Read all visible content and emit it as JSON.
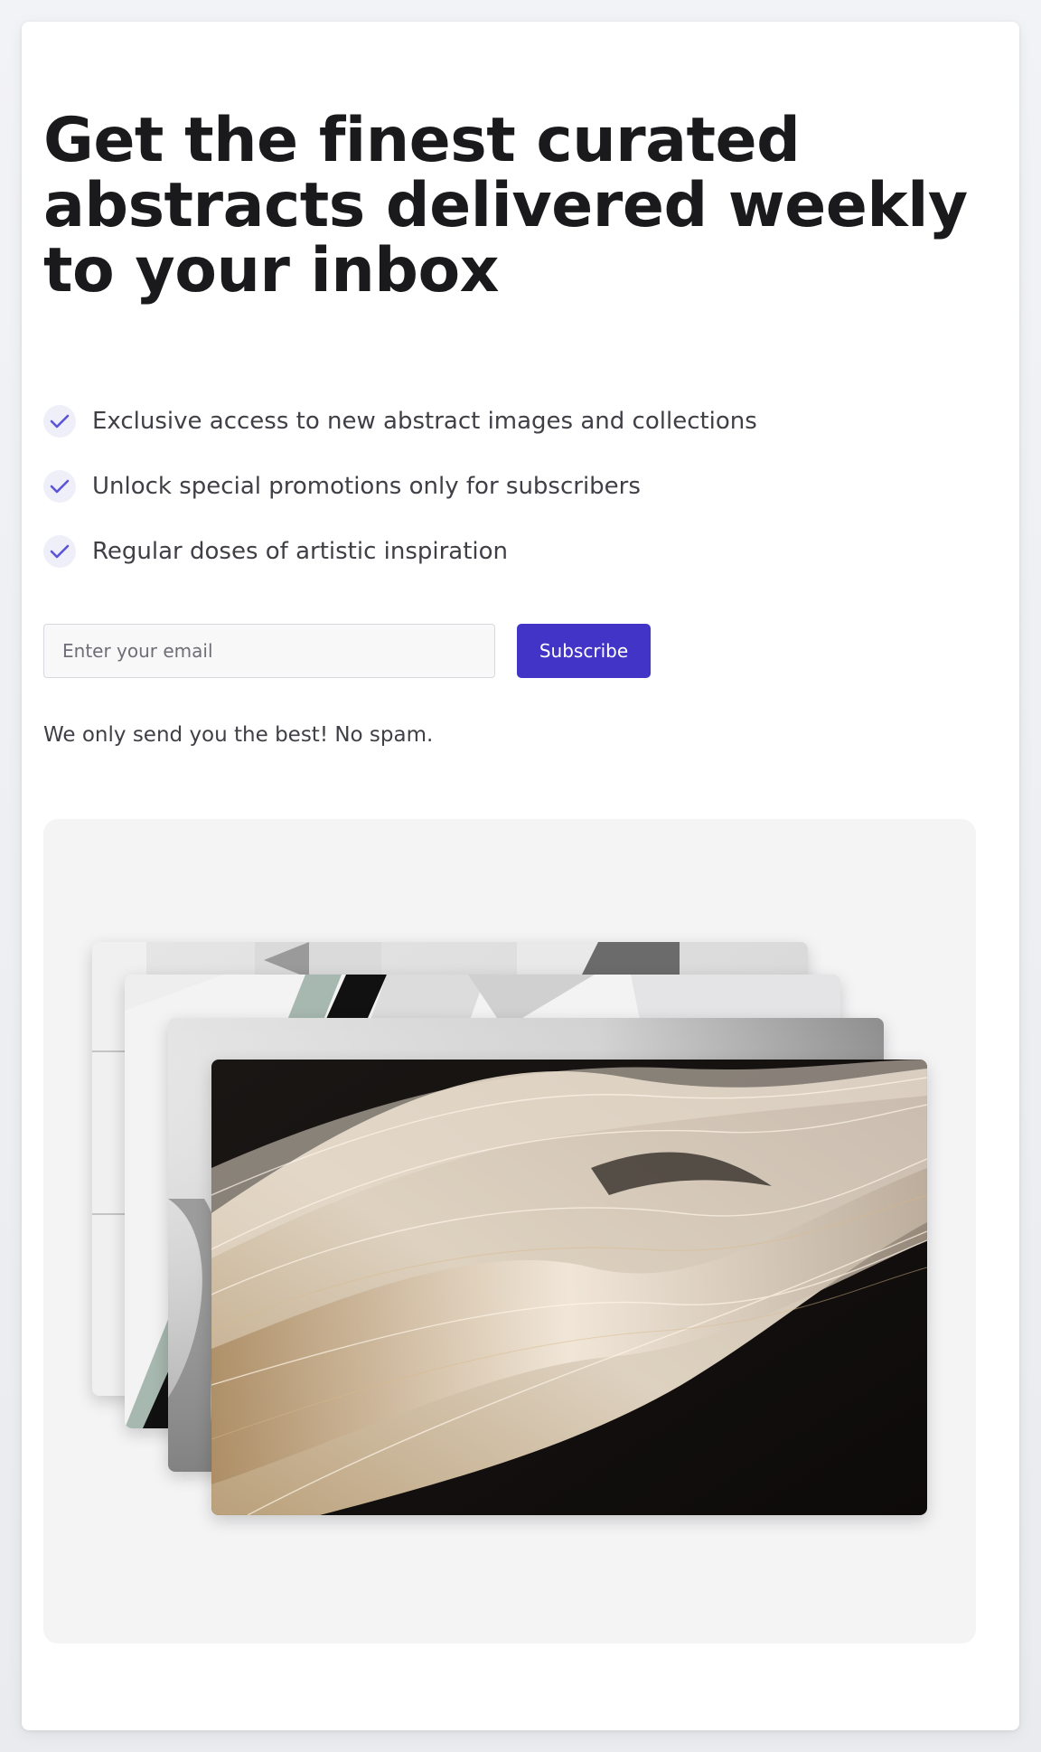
{
  "hero": {
    "title": "Get the finest curated abstracts delivered weekly to your inbox"
  },
  "features": [
    {
      "icon": "check-icon",
      "text": "Exclusive access to new abstract images and collections"
    },
    {
      "icon": "check-icon",
      "text": "Unlock special promotions only for subscribers"
    },
    {
      "icon": "check-icon",
      "text": "Regular doses of artistic inspiration"
    }
  ],
  "form": {
    "email_placeholder": "Enter your email",
    "email_value": "",
    "subscribe_label": "Subscribe"
  },
  "note": "We only send you the best! No spam.",
  "colors": {
    "accent": "#4334c8",
    "check": "#5b54d6",
    "check_bg": "#eeeff8"
  },
  "gallery": {
    "images": [
      {
        "name": "stacked-image-back",
        "description": "grey geometric architecture"
      },
      {
        "name": "stacked-image-second",
        "description": "white angular surfaces with black stripe"
      },
      {
        "name": "stacked-image-third",
        "description": "grey gradient wave"
      },
      {
        "name": "stacked-image-front",
        "description": "golden light trails abstract"
      }
    ]
  }
}
